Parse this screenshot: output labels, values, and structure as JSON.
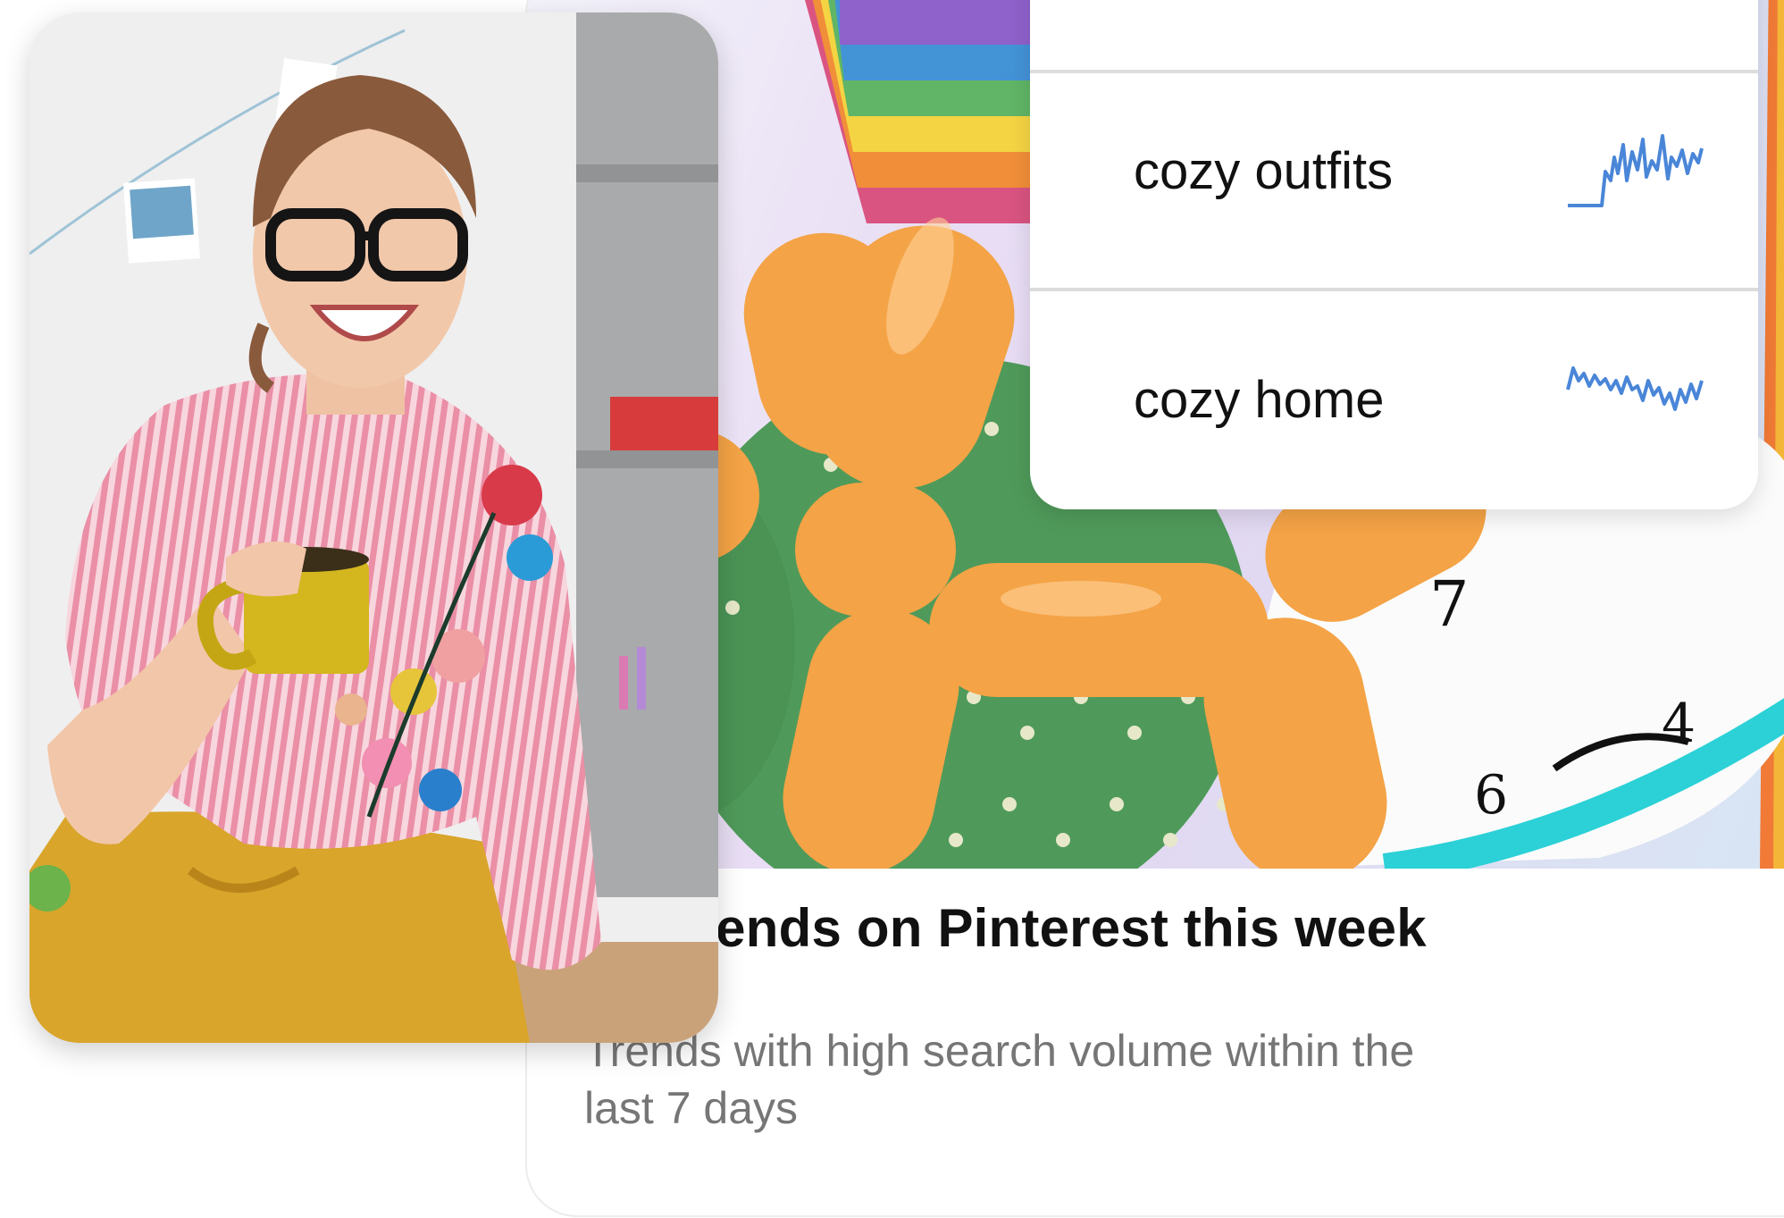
{
  "trends_card": {
    "title": "ing trends on Pinterest this week",
    "subtitle": "Trends with high search volume within the last 7 days"
  },
  "trend_list": {
    "items": [
      {
        "label": "cozy outfits",
        "icon": "sparkline-icon"
      },
      {
        "label": "cozy home",
        "icon": "sparkline-icon"
      }
    ]
  },
  "colors": {
    "sparkline": "#4a86d8",
    "balloon": "#f4a346",
    "cactus": "#4f9a5a",
    "shirt": "#f0a0b4",
    "skirt": "#d9a52a",
    "mug": "#d4b61e"
  }
}
